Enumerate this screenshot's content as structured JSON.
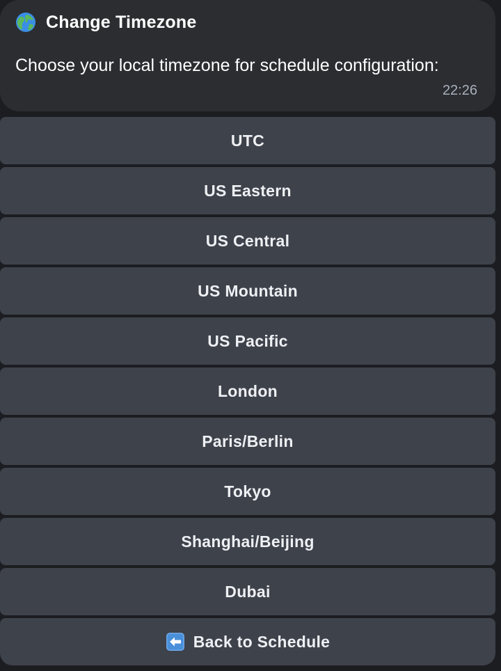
{
  "message": {
    "title": "Change Timezone",
    "title_icon": "globe-icon",
    "body": "Choose your local timezone for schedule configuration:",
    "time": "22:26"
  },
  "buttons": [
    {
      "label": "UTC"
    },
    {
      "label": "US Eastern"
    },
    {
      "label": "US Central"
    },
    {
      "label": "US Mountain"
    },
    {
      "label": "US Pacific"
    },
    {
      "label": "London"
    },
    {
      "label": "Paris/Berlin"
    },
    {
      "label": "Tokyo"
    },
    {
      "label": "Shanghai/Beijing"
    },
    {
      "label": "Dubai"
    }
  ],
  "back_button": {
    "icon": "back-arrow-icon",
    "label": "Back to Schedule"
  },
  "colors": {
    "background": "#1c1d21",
    "message_bubble": "#2b2d31",
    "button": "#3e424b",
    "timestamp": "#a9b0bd"
  }
}
